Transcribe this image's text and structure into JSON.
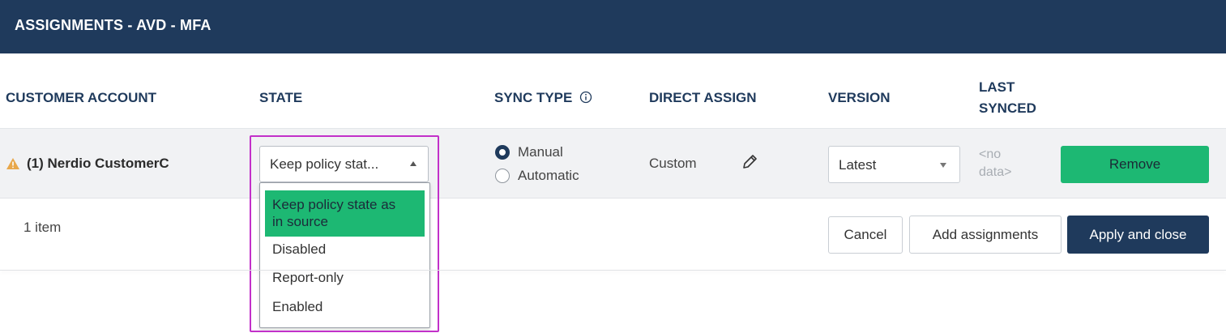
{
  "dialog": {
    "title": "ASSIGNMENTS - AVD - MFA"
  },
  "columns": {
    "customer_account": "CUSTOMER ACCOUNT",
    "state": "STATE",
    "sync_type": "SYNC TYPE",
    "direct_assign": "DIRECT ASSIGN",
    "version": "VERSION",
    "last_synced_line1": "LAST",
    "last_synced_line2": "SYNCED"
  },
  "row": {
    "account": "(1) Nerdio CustomerC",
    "state_value": "Keep policy stat...",
    "sync_options": [
      "Manual",
      "Automatic"
    ],
    "sync_selected": "Manual",
    "direct_assign": "Custom",
    "version_value": "Latest",
    "last_synced_line1": "<no",
    "last_synced_line2": "data>",
    "remove_label": "Remove"
  },
  "state_dropdown": {
    "options": [
      "Keep policy state as in source",
      "Disabled",
      "Report-only",
      "Enabled"
    ],
    "selected_line1": "Keep policy state as",
    "selected_line2": "in source"
  },
  "footer": {
    "item_count": "1 item",
    "cancel_label": "Cancel",
    "add_label": "Add assignments",
    "apply_label": "Apply and close"
  },
  "colors": {
    "header_bg": "#1f3a5c",
    "accent_green": "#1db873",
    "highlight": "#c230c9",
    "warning": "#e8a74a"
  },
  "icons": {
    "warning": "warning-triangle-icon",
    "info": "info-circle-icon",
    "edit": "pencil-icon",
    "caret_up": "caret-up-icon",
    "caret_down": "caret-down-icon"
  }
}
